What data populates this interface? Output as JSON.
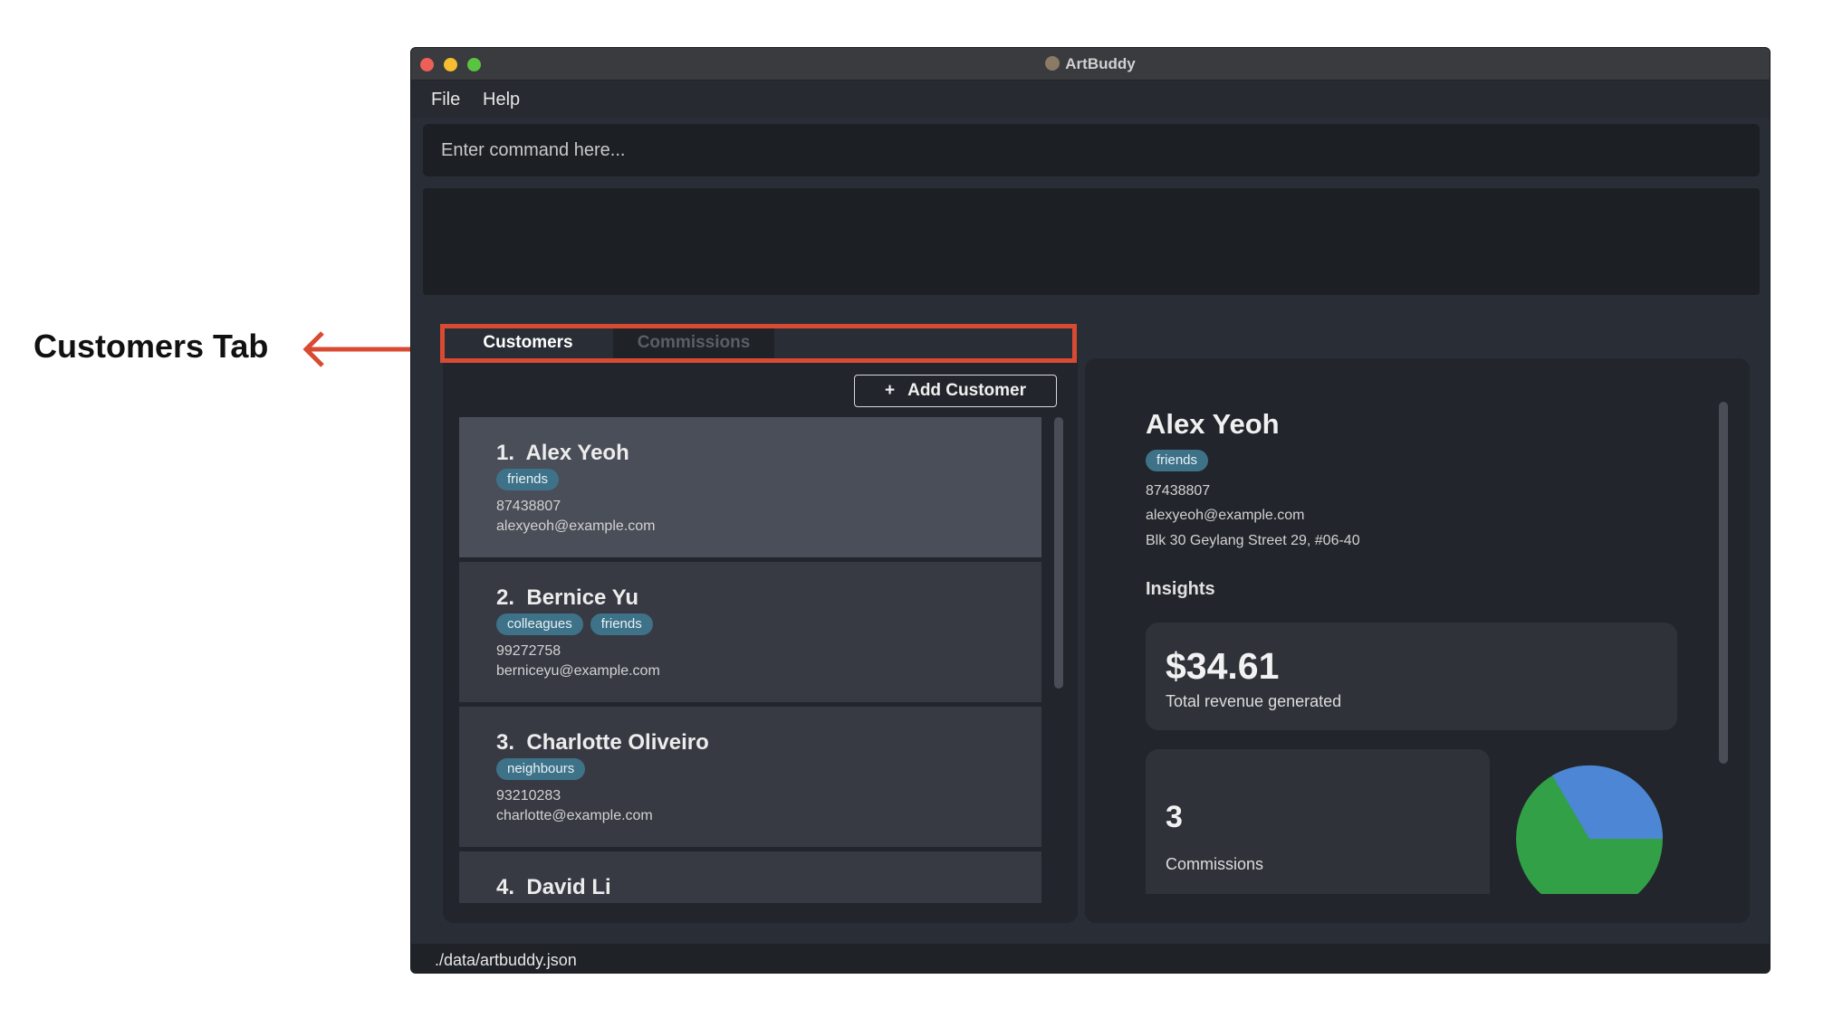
{
  "annotation": {
    "label": "Customers Tab",
    "color": "#d94a33"
  },
  "window": {
    "title": "ArtBuddy",
    "app_icon": "artbuddy-icon"
  },
  "menu": {
    "file": "File",
    "help": "Help"
  },
  "command": {
    "placeholder": "Enter command here..."
  },
  "tabs": {
    "customers": "Customers",
    "commissions": "Commissions"
  },
  "toolbar": {
    "add_icon": "+",
    "add_label": "Add Customer"
  },
  "customers": [
    {
      "index": "1.",
      "name": "Alex Yeoh",
      "tags": [
        "friends"
      ],
      "phone": "87438807",
      "email": "alexyeoh@example.com",
      "selected": true
    },
    {
      "index": "2.",
      "name": "Bernice Yu",
      "tags": [
        "colleagues",
        "friends"
      ],
      "phone": "99272758",
      "email": "berniceyu@example.com"
    },
    {
      "index": "3.",
      "name": "Charlotte Oliveiro",
      "tags": [
        "neighbours"
      ],
      "phone": "93210283",
      "email": "charlotte@example.com"
    },
    {
      "index": "4.",
      "name": "David Li",
      "tags": [],
      "phone": "",
      "email": ""
    }
  ],
  "detail": {
    "name": "Alex Yeoh",
    "tags": [
      "friends"
    ],
    "phone": "87438807",
    "email": "alexyeoh@example.com",
    "address": "Blk 30 Geylang Street 29, #06-40",
    "insights_title": "Insights",
    "revenue": {
      "value": "$34.61",
      "label": "Total revenue generated"
    },
    "commissions": {
      "value": "3",
      "label": "Commissions"
    },
    "pie_colors": {
      "primary": "#31a046",
      "secondary": "#4c86d4"
    }
  },
  "status": {
    "path": "./data/artbuddy.json"
  },
  "colors": {
    "tag": "#3e7289",
    "selected_card": "#4a4e58",
    "card": "#373a43"
  }
}
